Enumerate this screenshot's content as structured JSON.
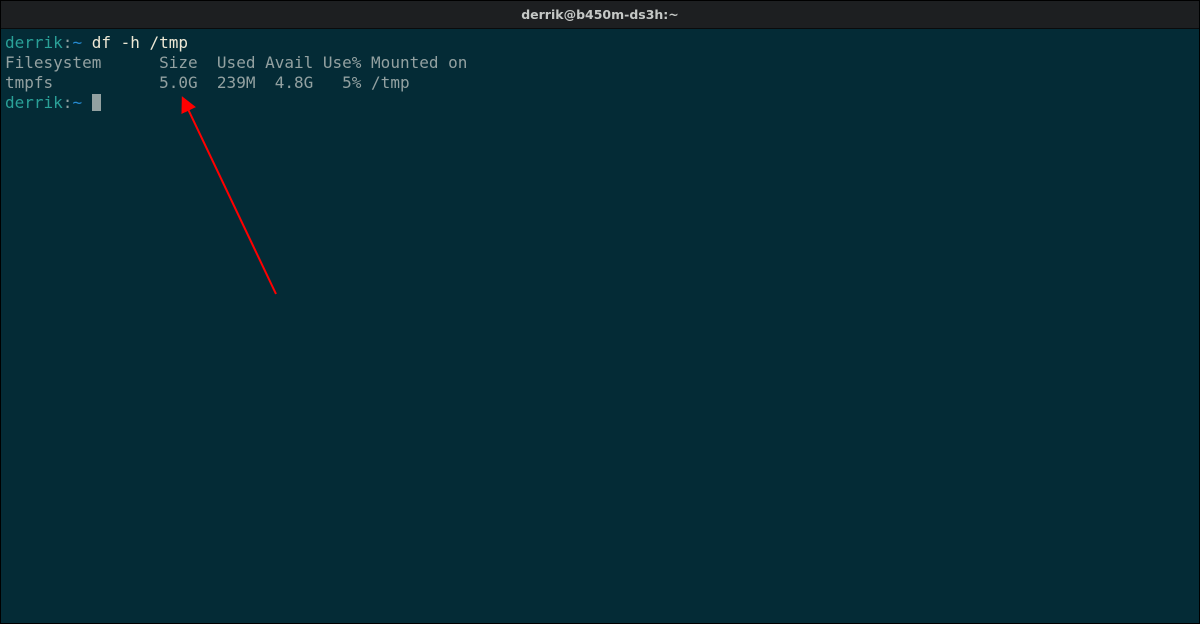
{
  "titlebar": {
    "text": "derrik@b450m-ds3h:~"
  },
  "prompt": {
    "user": "derrik",
    "sep": ":",
    "path": "~",
    "space": " "
  },
  "command": {
    "text": "df -h /tmp"
  },
  "output": {
    "header": "Filesystem      Size  Used Avail Use% Mounted on",
    "row": "tmpfs           5.0G  239M  4.8G   5% /tmp"
  },
  "annotation": {
    "arrow_color": "#ff0000"
  }
}
